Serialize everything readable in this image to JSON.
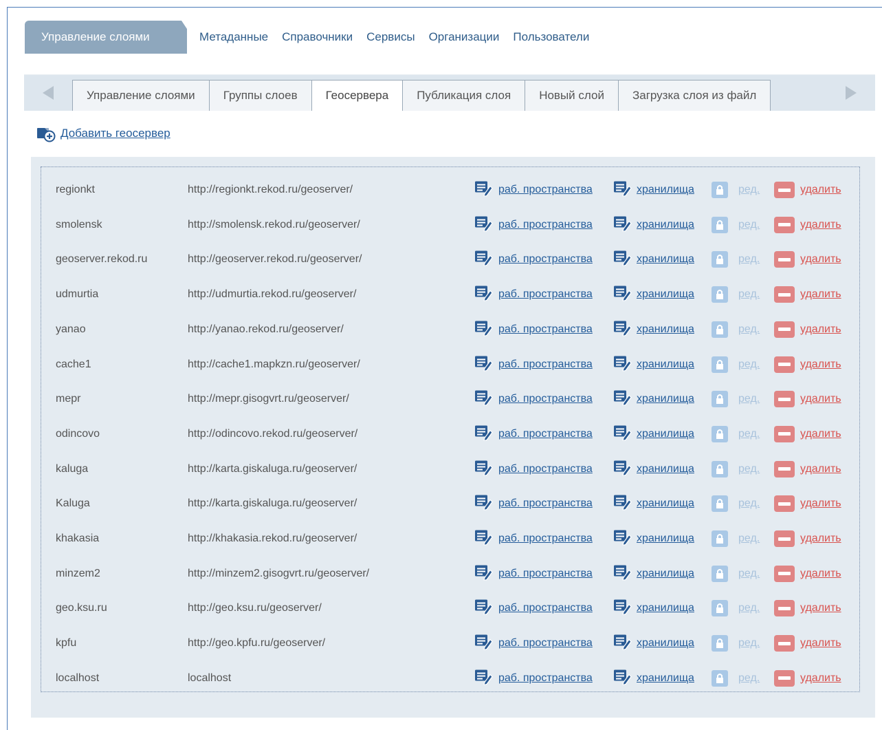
{
  "nav": {
    "active": "Управление слоями",
    "links": [
      "Метаданные",
      "Справочники",
      "Сервисы",
      "Организации",
      "Пользователи"
    ]
  },
  "tabs": [
    {
      "label": "Управление слоями",
      "selected": false
    },
    {
      "label": "Группы слоев",
      "selected": false
    },
    {
      "label": "Геосервера",
      "selected": true
    },
    {
      "label": "Публикация слоя",
      "selected": false
    },
    {
      "label": "Новый слой",
      "selected": false
    },
    {
      "label": "Загрузка слоя из файл",
      "selected": false
    }
  ],
  "add_link": "Добавить геосервер",
  "actions": {
    "workspaces": "раб. пространства",
    "stores": "хранилища",
    "edit": "ред.",
    "delete": "удалить"
  },
  "colors": {
    "link": "#245c9a",
    "link_disabled": "#a8c2dc",
    "delete": "#d9534f",
    "panel": "#e4ebf1",
    "active_tab": "#8ea7bd"
  },
  "servers": [
    {
      "name": "regionkt",
      "url": "http://regionkt.rekod.ru/geoserver/"
    },
    {
      "name": "smolensk",
      "url": "http://smolensk.rekod.ru/geoserver/"
    },
    {
      "name": "geoserver.rekod.ru",
      "url": "http://geoserver.rekod.ru/geoserver/"
    },
    {
      "name": "udmurtia",
      "url": "http://udmurtia.rekod.ru/geoserver/"
    },
    {
      "name": "yanao",
      "url": "http://yanao.rekod.ru/geoserver/"
    },
    {
      "name": "cache1",
      "url": "http://cache1.mapkzn.ru/geoserver/"
    },
    {
      "name": "mepr",
      "url": "http://mepr.gisogvrt.ru/geoserver/"
    },
    {
      "name": "odincovo",
      "url": "http://odincovo.rekod.ru/geoserver/"
    },
    {
      "name": "kaluga",
      "url": "http://karta.giskaluga.ru/geoserver/"
    },
    {
      "name": "Kaluga",
      "url": "http://karta.giskaluga.ru/geoserver/"
    },
    {
      "name": "khakasia",
      "url": "http://khakasia.rekod.ru/geoserver/"
    },
    {
      "name": "minzem2",
      "url": "http://minzem2.gisogvrt.ru/geoserver/"
    },
    {
      "name": "geo.ksu.ru",
      "url": "http://geo.ksu.ru/geoserver/"
    },
    {
      "name": "kpfu",
      "url": "http://geo.kpfu.ru/geoserver/"
    },
    {
      "name": "localhost",
      "url": "localhost"
    }
  ]
}
